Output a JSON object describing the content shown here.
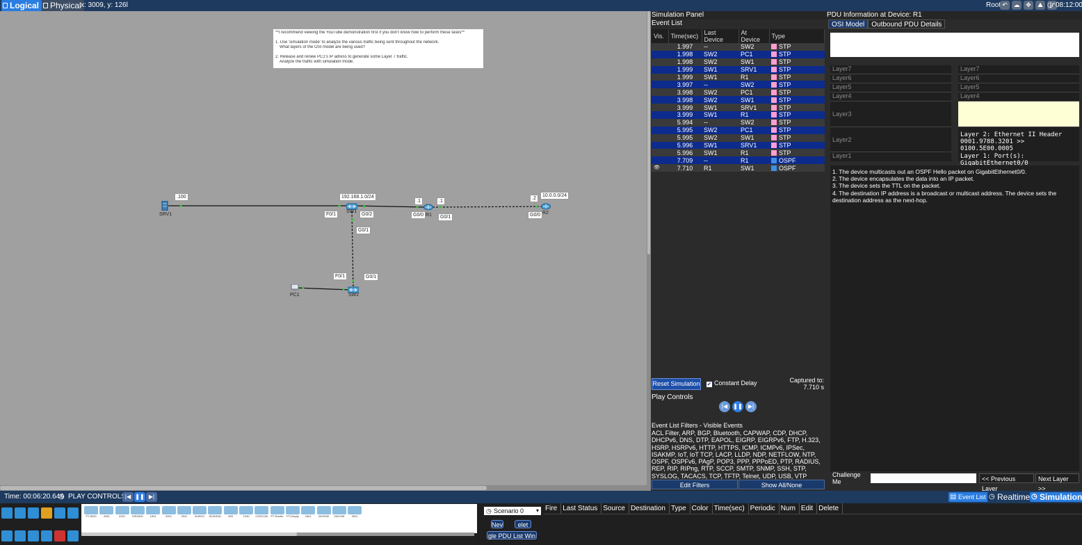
{
  "topbar": {
    "logical": "Logical",
    "physical": "Physical",
    "coords": "x: 3009, y: 126l",
    "root": "Root",
    "clock": "08:12:00"
  },
  "canvas": {
    "note": [
      "**I recommend viewing the YouTube demonstration first if you don't know how to perform these tasks**",
      "",
      "1. Use 'simulation mode' to analyze the various traffic being sent throughout the network.",
      "   What layers of the OSI model are being used?",
      "",
      "2. Release and renew PC1's IP adress to generate some Layer 7 traffic.",
      "   Analyze the traffic with simulation mode."
    ],
    "labels": {
      "srv_ip": ".100",
      "lan_net": "192.168.1.0/24",
      "r1_a": ".1",
      "r1_b": ".1",
      "r2_ip": ".2",
      "wan_net": "10.0.0.0/24",
      "sw1_f01": "F0/1",
      "sw1_g02": "G0/2",
      "sw1_g01": "G0/1",
      "r1_g00": "G0/0",
      "r1_g01": "G0/1",
      "r2_g00": "G0/0",
      "sw2_f01": "F0/1",
      "sw2_g01": "G0/1"
    },
    "devices": {
      "srv1": "SRV1",
      "sw1": "SW1",
      "r1": "R1",
      "r2": "R2",
      "pc1": "PC1",
      "sw2": "SW2"
    }
  },
  "sim": {
    "title": "Simulation Panel",
    "event_list": "Event List",
    "columns": [
      "Vis.",
      "Time(sec)",
      "Last Device",
      "At Device",
      "Type"
    ],
    "events": [
      {
        "time": "1.997",
        "last": "--",
        "at": "SW2",
        "type": "STP",
        "color": "#ff9ed0",
        "style": "odd"
      },
      {
        "time": "1.998",
        "last": "SW2",
        "at": "PC1",
        "type": "STP",
        "color": "#ff9ed0",
        "style": "sel"
      },
      {
        "time": "1.998",
        "last": "SW2",
        "at": "SW1",
        "type": "STP",
        "color": "#ff9ed0",
        "style": "odd"
      },
      {
        "time": "1.999",
        "last": "SW1",
        "at": "SRV1",
        "type": "STP",
        "color": "#ff9ed0",
        "style": "sel"
      },
      {
        "time": "1.999",
        "last": "SW1",
        "at": "R1",
        "type": "STP",
        "color": "#ff9ed0",
        "style": "odd"
      },
      {
        "time": "3.997",
        "last": "--",
        "at": "SW2",
        "type": "STP",
        "color": "#ff9ed0",
        "style": "sel"
      },
      {
        "time": "3.998",
        "last": "SW2",
        "at": "PC1",
        "type": "STP",
        "color": "#ff9ed0",
        "style": "odd"
      },
      {
        "time": "3.998",
        "last": "SW2",
        "at": "SW1",
        "type": "STP",
        "color": "#ff9ed0",
        "style": "sel"
      },
      {
        "time": "3.999",
        "last": "SW1",
        "at": "SRV1",
        "type": "STP",
        "color": "#ff9ed0",
        "style": "odd"
      },
      {
        "time": "3.999",
        "last": "SW1",
        "at": "R1",
        "type": "STP",
        "color": "#ff9ed0",
        "style": "sel"
      },
      {
        "time": "5.994",
        "last": "--",
        "at": "SW2",
        "type": "STP",
        "color": "#ff9ed0",
        "style": "odd"
      },
      {
        "time": "5.995",
        "last": "SW2",
        "at": "PC1",
        "type": "STP",
        "color": "#ff9ed0",
        "style": "sel"
      },
      {
        "time": "5.995",
        "last": "SW2",
        "at": "SW1",
        "type": "STP",
        "color": "#ff9ed0",
        "style": "odd"
      },
      {
        "time": "5.996",
        "last": "SW1",
        "at": "SRV1",
        "type": "STP",
        "color": "#ff9ed0",
        "style": "sel"
      },
      {
        "time": "5.996",
        "last": "SW1",
        "at": "R1",
        "type": "STP",
        "color": "#ff9ed0",
        "style": "odd"
      },
      {
        "time": "7.709",
        "last": "--",
        "at": "R1",
        "type": "OSPF",
        "color": "#3f8fe8",
        "style": "sel"
      },
      {
        "time": "7.710",
        "last": "R1",
        "at": "SW1",
        "type": "OSPF",
        "color": "#3f8fe8",
        "style": "odd",
        "eye": true
      }
    ],
    "reset": "Reset Simulation",
    "constant_delay": "Constant Delay",
    "captured_lbl": "Captured to:",
    "captured_val": "7.710 s",
    "play_controls": "Play Controls",
    "filters_lbl": "Event List Filters - Visible Events",
    "filters": "ACL Filter, ARP, BGP, Bluetooth, CAPWAP, CDP, DHCP, DHCPv6, DNS, DTP, EAPOL, EIGRP, EIGRPv6, FTP, H.323, HSRP, HSRPv6, HTTP, HTTPS, ICMP, ICMPv6, IPSec, ISAKMP, IoT, IoT TCP, LACP, LLDP, NDP, NETFLOW, NTP, OSPF, OSPFv6, PAgP, POP3, PPP, PPPoED, PTP, RADIUS, REP, RIP, RIPng, RTP, SCCP, SMTP, SNMP, SSH, STP, SYSLOG, TACACS, TCP, TFTP, Telnet, UDP, USB, VTP",
    "edit_filters": "Edit Filters",
    "show_all": "Show All/None"
  },
  "pdu": {
    "title": "PDU Information at Device: R1",
    "tab_osi": "OSI Model",
    "tab_outbound": "Outbound PDU Details",
    "left_layers": [
      "Layer7",
      "Layer6",
      "Layer5",
      "Layer4",
      "Layer3",
      "Layer2",
      "Layer1"
    ],
    "right_layers": [
      "Layer7",
      "Layer6",
      "Layer5",
      "Layer4"
    ],
    "l2_header": "Layer 2: Ethernet II Header",
    "l2_addr": "0001.9788.3201 >> 0100.5E00.0005",
    "l1": "Layer 1: Port(s): GigabitEthernet0/0",
    "desc": [
      "1. The device multicasts out an OSPF Hello packet on GigabitEthernet0/0.",
      "2. The device encapsulates the data into an IP packet.",
      "3. The device sets the TTL on the packet.",
      "4. The destination IP address is a broadcast or multicast address. The device sets the destination address as the next-hop."
    ],
    "challenge": "Challenge Me",
    "prev_layer": "<< Previous Layer",
    "next_layer": "Next Layer >>"
  },
  "bottom": {
    "time": "Time: 00:06:20.646",
    "play_controls": "PLAY CONTROLS",
    "event_list": "Event List",
    "realtime": "Realtime",
    "simulation": "Simulation"
  },
  "palette": {
    "models": [
      "PT-8200",
      "4331",
      "4321",
      "ISR4300",
      "1941",
      "2901",
      "2911",
      "819IOX",
      "819HGW",
      "829",
      "1240",
      "CGR1240",
      "PT-Router",
      "PT-Empty",
      "1841",
      "2620XM",
      "2621XM",
      "2811"
    ]
  },
  "scenario": {
    "select": "Scenario 0",
    "new": "New",
    "delete": "Delete",
    "toggle": "Toggle PDU List Window",
    "new_visible": "Nev",
    "delete_visible": "elet",
    "toggle_visible": "gle PDU List Win",
    "columns": [
      "Fire",
      "Last Status",
      "Source",
      "Destination",
      "Type",
      "Color",
      "Time(sec)",
      "Periodic",
      "Num",
      "Edit",
      "Delete"
    ]
  },
  "colors": {
    "accent": "#2a7de1",
    "selected_row": "#0c2b8c",
    "stp": "#ff9ed0",
    "ospf": "#3f8fe8",
    "active_layer": "#ffffd6"
  }
}
